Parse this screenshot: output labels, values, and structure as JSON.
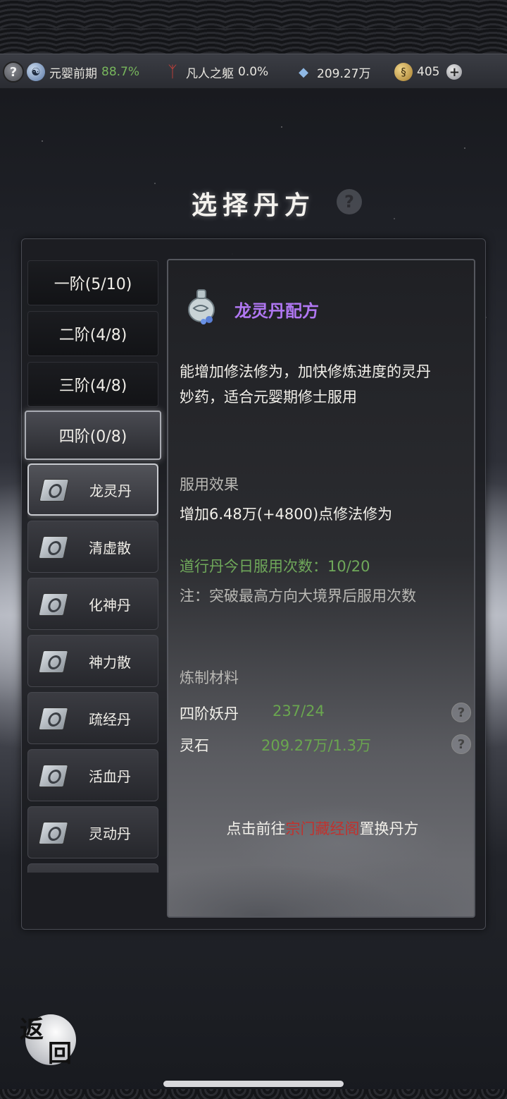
{
  "status_bar": {
    "help_glyph": "?",
    "realm": {
      "label": "元婴前期",
      "percent": "88.7%"
    },
    "body": {
      "label": "凡人之躯",
      "percent": "0.0%"
    },
    "spirit_stone": {
      "value": "209.27万"
    },
    "gold": {
      "value": "405"
    },
    "plus_glyph": "+"
  },
  "page": {
    "title": "选择丹方",
    "help_glyph": "?"
  },
  "tiers": [
    {
      "label": "一阶(5/10)"
    },
    {
      "label": "二阶(4/8)"
    },
    {
      "label": "三阶(4/8)"
    },
    {
      "label": "四阶(0/8)",
      "selected": true
    }
  ],
  "recipes": [
    {
      "name": "龙灵丹",
      "selected": true
    },
    {
      "name": "清虚散"
    },
    {
      "name": "化神丹"
    },
    {
      "name": "神力散"
    },
    {
      "name": "疏经丹"
    },
    {
      "name": "活血丹"
    },
    {
      "name": "灵动丹"
    }
  ],
  "detail": {
    "title": "龙灵丹配方",
    "title_color": "#b077f2",
    "description_line1": "能增加修法修为，加快修炼进度的灵丹",
    "description_line2": "妙药，适合元婴期修士服用",
    "effect_label": "服用效果",
    "effect_text": "增加6.48万(+4800)点修法修为",
    "today_usage": "道行丹今日服用次数：10/20",
    "note": "注：突破最高方向大境界后服用次数",
    "materials_label": "炼制材料",
    "materials": [
      {
        "name": "四阶妖丹",
        "value": "237/24",
        "help": "?"
      },
      {
        "name": "灵石",
        "value": "209.27万/1.3万",
        "help": "?"
      }
    ],
    "goto_prefix": "点击前往",
    "goto_link": "宗门藏经阁",
    "goto_suffix": "置换丹方",
    "link_color": "#c0322e"
  },
  "back": {
    "char1": "返",
    "char2": "回"
  },
  "icons": {
    "realm": "yin-yang-icon",
    "body": "body-rune-icon",
    "spirit_stone": "spirit-crystal-icon",
    "gold": "gold-coin-icon",
    "recipe": "scroll-icon",
    "detail": "pill-bottle-icon"
  }
}
